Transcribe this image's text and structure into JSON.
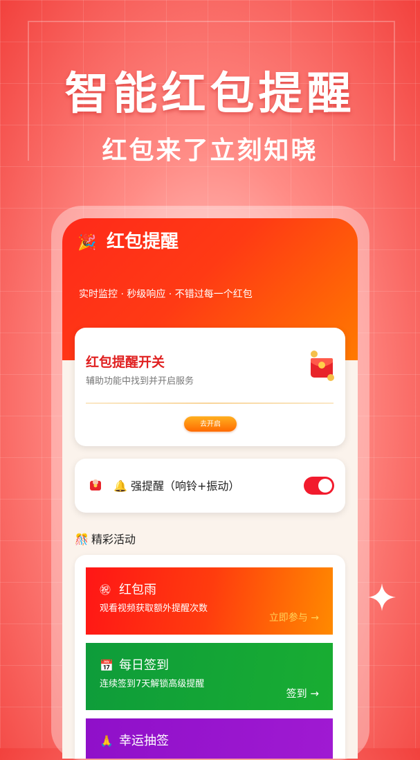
{
  "hero": {
    "title": "智能红包提醒",
    "subtitle": "红包来了立刻知晓"
  },
  "header": {
    "icon": "party-popper-icon",
    "title": "红包提醒",
    "tagline": "实时监控 · 秒级响应 · 不错过每一个红包"
  },
  "switch_card": {
    "title": "红包提醒开关",
    "description": "辅助功能中找到并开启服务",
    "button_label": "去开启",
    "icon": "red-envelope-icon"
  },
  "strong_alert": {
    "label": "🔔 强提醒（响铃+振动）",
    "enabled": true,
    "icon": "envelope-avatar-icon"
  },
  "activities": {
    "section_title": "精彩活动",
    "items": [
      {
        "icon": "㊗",
        "title": "红包雨",
        "desc": "观看视频获取额外提醒次数",
        "cta": "立即参与 →"
      },
      {
        "icon": "📅",
        "title": "每日签到",
        "desc": "连续签到7天解锁高级提醒",
        "cta": "签到 →"
      },
      {
        "icon": "🙏",
        "title": "幸运抽签",
        "desc": "",
        "cta": ""
      }
    ]
  },
  "colors": {
    "primary_red": "#ff2a1a",
    "accent_orange": "#ff7a00",
    "green": "#19ad32",
    "purple": "#a01ad2",
    "toggle_on": "#f21b2d"
  }
}
